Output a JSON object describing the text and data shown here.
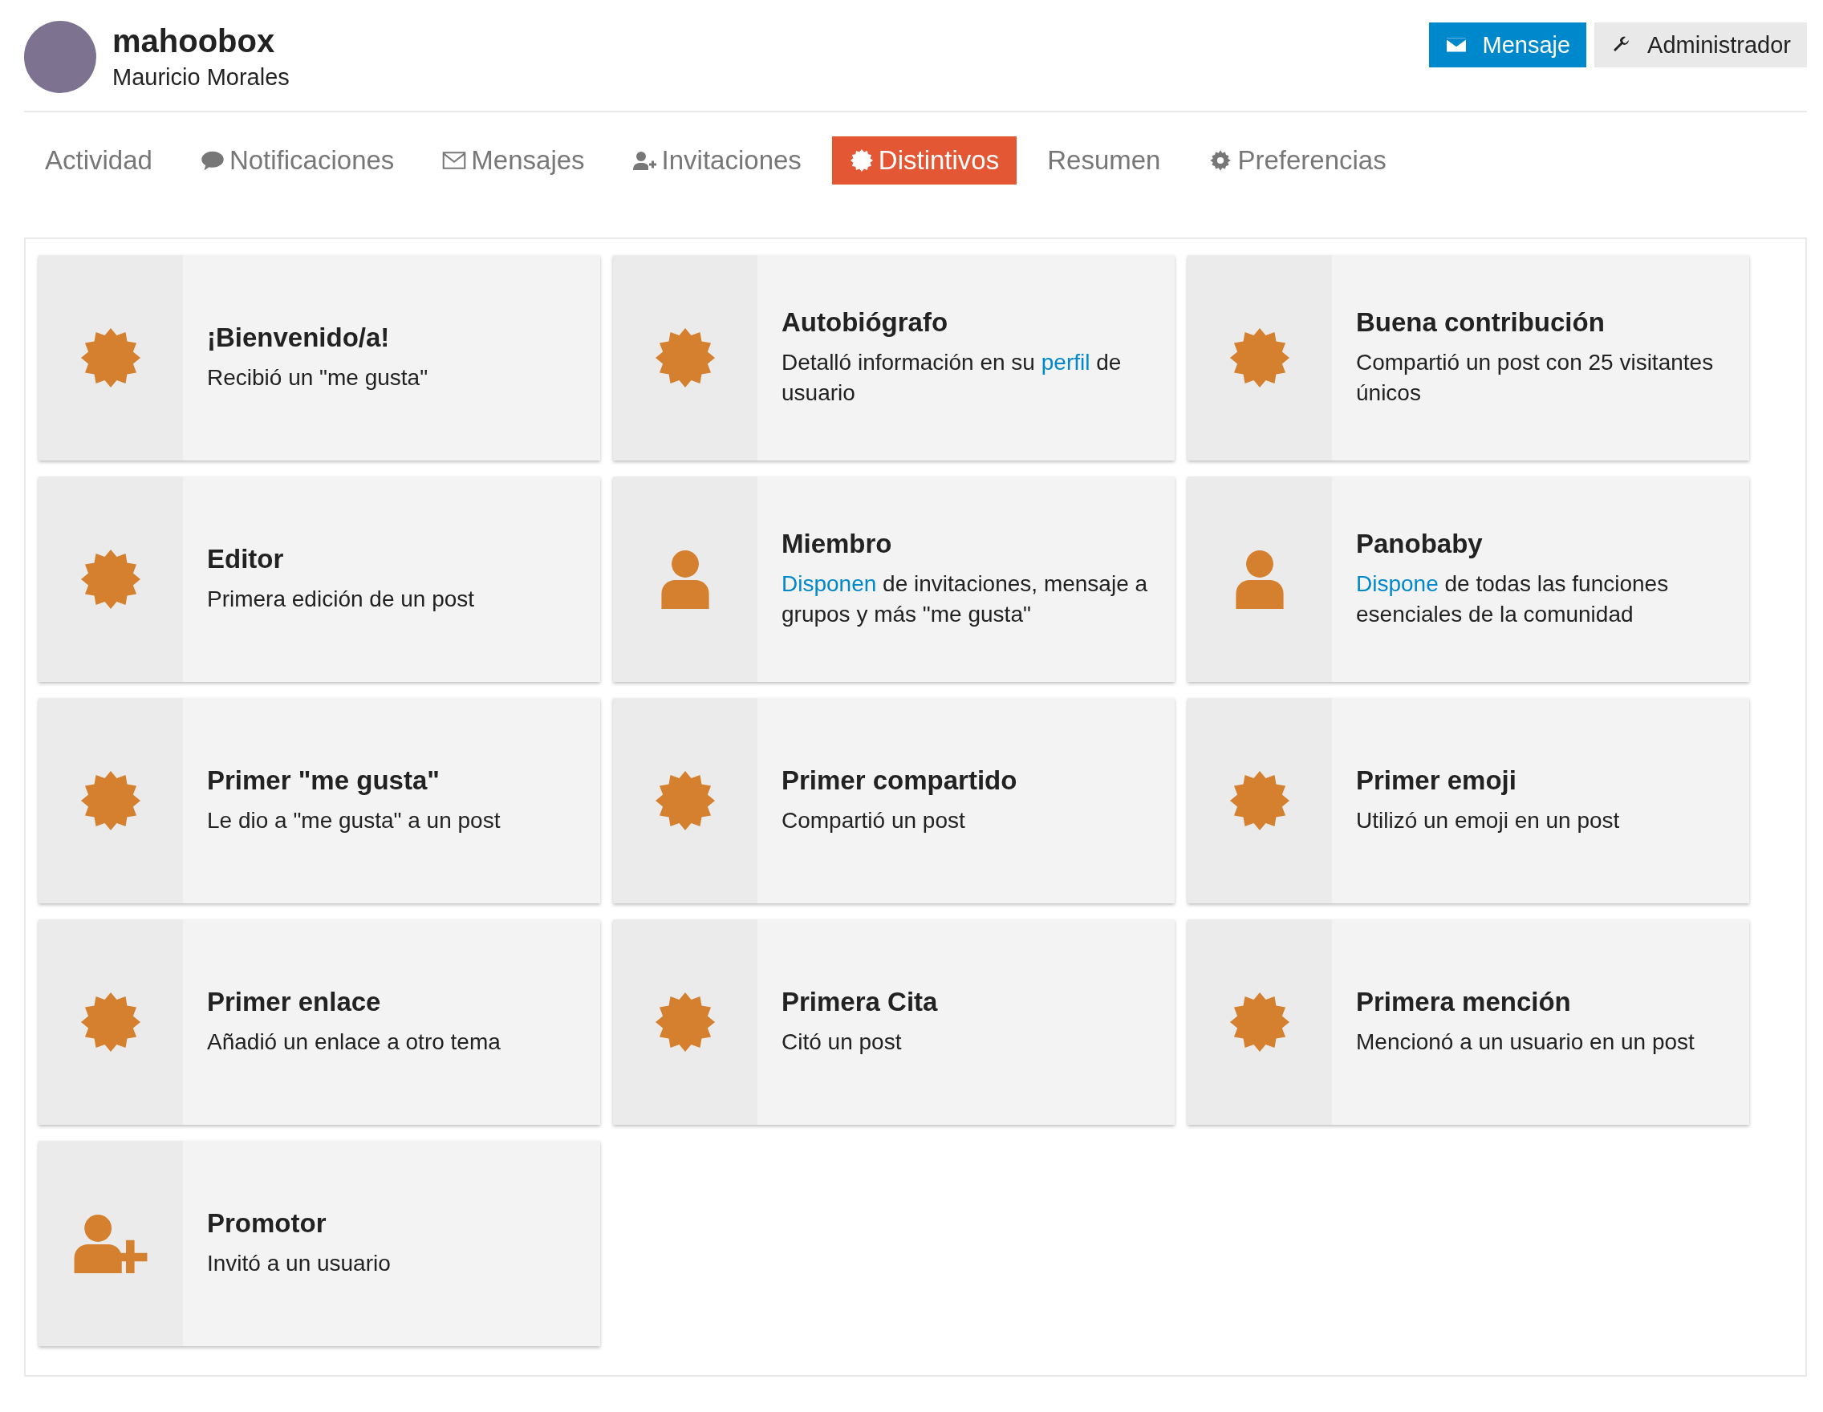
{
  "profile": {
    "username": "mahoobox",
    "name": "Mauricio Morales"
  },
  "actions": [
    {
      "label": "Mensaje",
      "kind": "primary"
    },
    {
      "label": "Administrador",
      "kind": "default"
    }
  ],
  "tabs": [
    {
      "label": "Actividad",
      "kind": "plain",
      "selected": false
    },
    {
      "label": "Notificaciones",
      "kind": "comment",
      "selected": false
    },
    {
      "label": "Mensajes",
      "kind": "envelope",
      "selected": false
    },
    {
      "label": "Invitaciones",
      "kind": "invite",
      "selected": false
    },
    {
      "label": "Distintivos",
      "kind": "badge",
      "selected": true
    },
    {
      "label": "Resumen",
      "kind": "plain",
      "selected": false
    },
    {
      "label": "Preferencias",
      "kind": "gear",
      "selected": false
    }
  ],
  "badges": [
    {
      "kind": "badge",
      "title": "¡Bienvenido/a!",
      "description": [
        {
          "text": "Recibió un \"me gusta\"",
          "link": false
        }
      ]
    },
    {
      "kind": "badge",
      "title": "Autobiógrafo",
      "description": [
        {
          "text": "Detalló información en su ",
          "link": false
        },
        {
          "text": "perfil",
          "link": true
        },
        {
          "text": " de usuario",
          "link": false
        }
      ]
    },
    {
      "kind": "badge",
      "title": "Buena contribución",
      "description": [
        {
          "text": "Compartió un post con 25 visitantes únicos",
          "link": false
        }
      ]
    },
    {
      "kind": "badge",
      "title": "Editor",
      "description": [
        {
          "text": "Primera edición de un post",
          "link": false
        }
      ]
    },
    {
      "kind": "user",
      "title": "Miembro",
      "description": [
        {
          "text": "Disponen",
          "link": true
        },
        {
          "text": " de invitaciones, mensaje a grupos y más \"me gusta\"",
          "link": false
        }
      ]
    },
    {
      "kind": "user",
      "title": "Panobaby",
      "description": [
        {
          "text": "Dispone",
          "link": true
        },
        {
          "text": " de todas las funciones esenciales de la comunidad",
          "link": false
        }
      ]
    },
    {
      "kind": "badge",
      "title": "Primer \"me gusta\"",
      "description": [
        {
          "text": "Le dio a \"me gusta\" a un post",
          "link": false
        }
      ]
    },
    {
      "kind": "badge",
      "title": "Primer compartido",
      "description": [
        {
          "text": "Compartió un post",
          "link": false
        }
      ]
    },
    {
      "kind": "badge",
      "title": "Primer emoji",
      "description": [
        {
          "text": "Utilizó un emoji en un post",
          "link": false
        }
      ]
    },
    {
      "kind": "badge",
      "title": "Primer enlace",
      "description": [
        {
          "text": "Añadió un enlace a otro tema",
          "link": false
        }
      ]
    },
    {
      "kind": "badge",
      "title": "Primera Cita",
      "description": [
        {
          "text": "Citó un post",
          "link": false
        }
      ]
    },
    {
      "kind": "badge",
      "title": "Primera mención",
      "description": [
        {
          "text": "Mencionó a un usuario en un post",
          "link": false
        }
      ]
    },
    {
      "kind": "invite",
      "title": "Promotor",
      "description": [
        {
          "text": "Invitó a un usuario",
          "link": false
        }
      ]
    }
  ]
}
